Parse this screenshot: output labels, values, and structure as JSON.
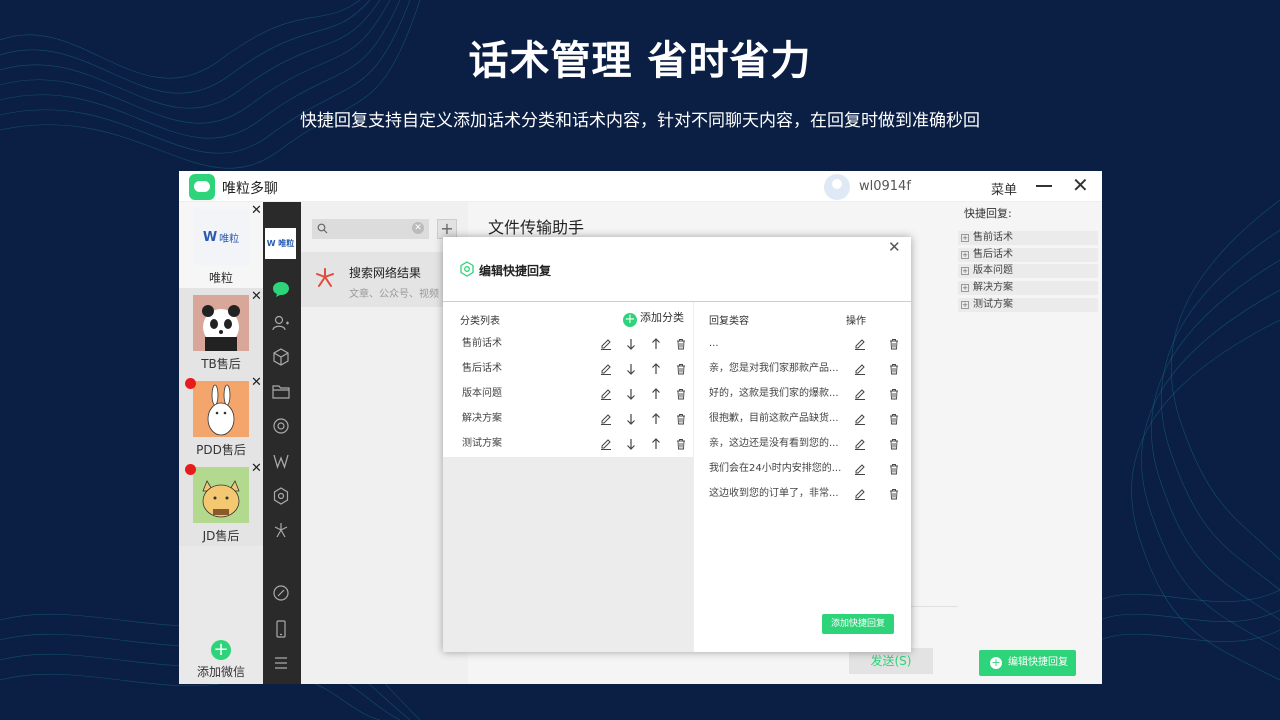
{
  "hero": {
    "title": "话术管理 省时省力",
    "subtitle": "快捷回复支持自定义添加话术分类和话术内容，针对不同聊天内容，在回复时做到准确秒回"
  },
  "app": {
    "name": "唯粒多聊",
    "user": "wl0914f",
    "menu_label": "菜单"
  },
  "accounts": [
    {
      "label": "唯粒",
      "logo_text": "唯粒",
      "unread": false
    },
    {
      "label": "TB售后",
      "unread": false
    },
    {
      "label": "PDD售后",
      "unread": true
    },
    {
      "label": "JD售后",
      "unread": true
    }
  ],
  "add_wechat_label": "添加微信",
  "conversation": {
    "title": "搜索网络结果",
    "subtitle": "文章、公众号、视频"
  },
  "chat": {
    "title": "文件传输助手",
    "send_label": "发送(S)"
  },
  "quick_reply_panel": {
    "title": "快捷回复:",
    "items": [
      "售前话术",
      "售后话术",
      "版本问题",
      "解决方案",
      "测试方案"
    ],
    "edit_button": "编辑快捷回复"
  },
  "modal": {
    "title": "编辑快捷回复",
    "category_header": "分类列表",
    "add_category": "添加分类",
    "reply_header": "回复类容",
    "action_header": "操作",
    "categories": [
      "售前话术",
      "售后话术",
      "版本问题",
      "解决方案",
      "测试方案"
    ],
    "replies": [
      "...",
      "亲，您是对我们家那款产品...",
      "好的，这款是我们家的爆款...",
      "很抱歉，目前这款产品缺货...",
      "亲，这边还是没有看到您的...",
      "我们会在24小时内安排您的...",
      "这边收到您的订单了，非常..."
    ],
    "add_reply_button": "添加快捷回复"
  },
  "colors": {
    "accent": "#2ed47a",
    "background": "#0b1f45",
    "unread_dot": "#e61c1c"
  }
}
